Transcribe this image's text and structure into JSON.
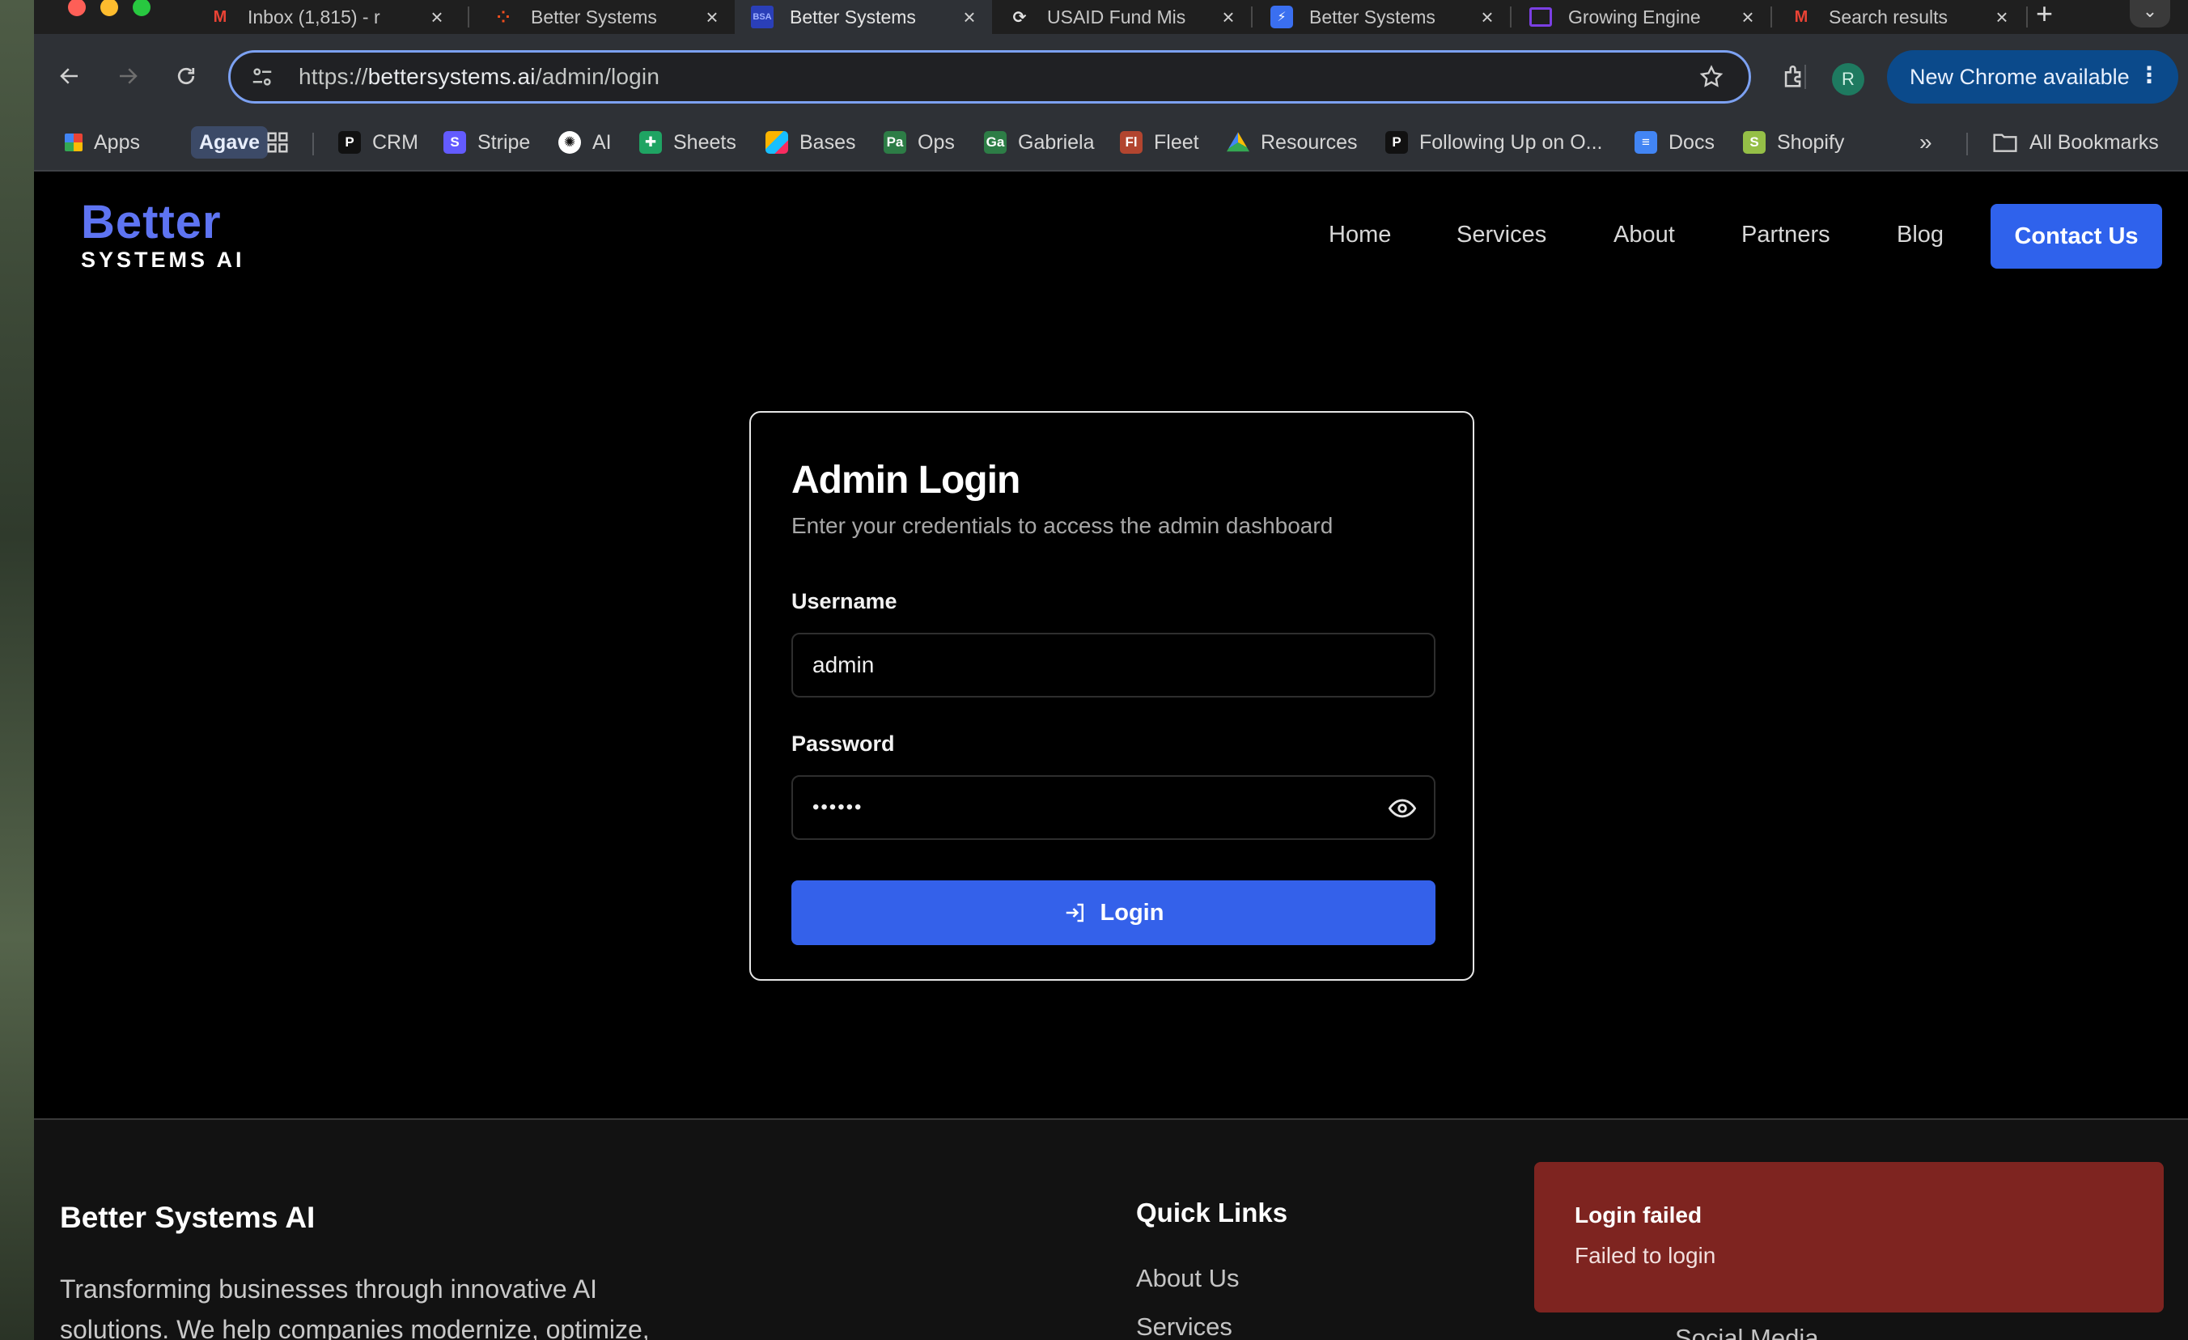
{
  "browser": {
    "tabs": [
      {
        "title": "Inbox (1,815) - r",
        "icon": "gmail-icon"
      },
      {
        "title": "Better Systems",
        "icon": "figma-icon"
      },
      {
        "title": "Better Systems",
        "icon": "bsa-icon",
        "active": true
      },
      {
        "title": "USAID Fund Mis",
        "icon": "sync-icon"
      },
      {
        "title": "Better Systems",
        "icon": "bolt-icon"
      },
      {
        "title": "Growing Engine",
        "icon": "slides-icon"
      },
      {
        "title": "Search results",
        "icon": "gmail-icon"
      }
    ],
    "url_prefix": "https://",
    "url_host": "bettersystems.ai",
    "url_path": "/admin/login",
    "profile_initial": "R",
    "update_label": "New Chrome available",
    "bookmarks": [
      {
        "label": "Apps",
        "icon": "apps-grid-icon",
        "color": "#e8453c"
      },
      {
        "label": "Agave",
        "icon": "",
        "color": ""
      },
      {
        "label": "CRM",
        "icon": "p-icon",
        "color": "#222222"
      },
      {
        "label": "Stripe",
        "icon": "stripe-icon",
        "color": "#635bff"
      },
      {
        "label": "AI",
        "icon": "openai-icon",
        "color": "#ffffff"
      },
      {
        "label": "Sheets",
        "icon": "sheets-icon",
        "color": "#1fa463"
      },
      {
        "label": "Bases",
        "icon": "airtable-icon",
        "color": "#fcb400"
      },
      {
        "label": "Ops",
        "icon": "pa-icon",
        "color": "#2d7d46"
      },
      {
        "label": "Gabriela",
        "icon": "ga-icon",
        "color": "#2d7d46"
      },
      {
        "label": "Fleet",
        "icon": "fl-icon",
        "color": "#b2452f"
      },
      {
        "label": "Resources",
        "icon": "drive-icon",
        "color": "#4285f4"
      },
      {
        "label": "Following Up on O...",
        "icon": "p-icon",
        "color": "#222222"
      },
      {
        "label": "Docs",
        "icon": "docs-icon",
        "color": "#4285f4"
      },
      {
        "label": "Shopify",
        "icon": "shopify-icon",
        "color": "#95bf47"
      }
    ],
    "bookmark_badges": {
      "ops": "Pa",
      "gabriela": "Ga",
      "fleet": "Fl",
      "crm": "P",
      "stripe": "S"
    },
    "all_bookmarks_label": "All Bookmarks"
  },
  "site": {
    "logo_line1": "Better",
    "logo_line2": "SYSTEMS AI",
    "nav": [
      "Home",
      "Services",
      "About",
      "Partners",
      "Blog"
    ],
    "contact_label": "Contact Us",
    "accent": "#2f62ec",
    "brand": "#5e74f2"
  },
  "login": {
    "title": "Admin Login",
    "subtitle": "Enter your credentials to access the admin dashboard",
    "username_label": "Username",
    "username_value": "admin",
    "password_label": "Password",
    "password_value": "••••••",
    "button_label": "Login"
  },
  "footer": {
    "title": "Better Systems AI",
    "description": "Transforming businesses through innovative AI solutions. We help companies modernize, optimize,",
    "quick_links_title": "Quick Links",
    "quick_links": [
      "About Us",
      "Services"
    ],
    "social_label": "Social Media"
  },
  "toast": {
    "title": "Login failed",
    "message": "Failed to login",
    "color": "#7e2420"
  }
}
